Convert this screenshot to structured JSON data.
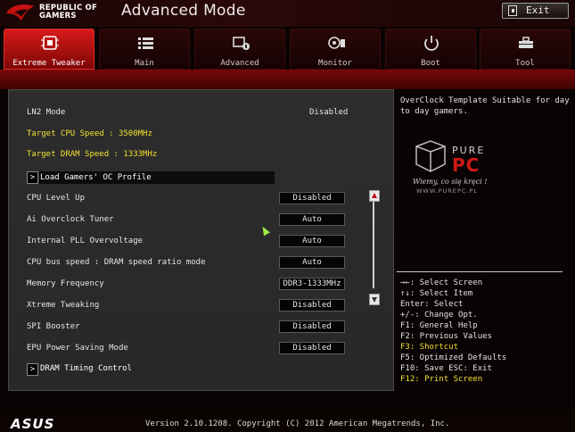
{
  "header": {
    "brand_line1": "REPUBLIC OF",
    "brand_line2": "GAMERS",
    "title": "Advanced Mode",
    "exit_label": "Exit"
  },
  "tabs": [
    {
      "label": "Extreme Tweaker",
      "icon": "cpu-chip-icon",
      "active": true
    },
    {
      "label": "Main",
      "icon": "list-icon",
      "active": false
    },
    {
      "label": "Advanced",
      "icon": "settings-info-icon",
      "active": false
    },
    {
      "label": "Monitor",
      "icon": "fan-gauge-icon",
      "active": false
    },
    {
      "label": "Boot",
      "icon": "power-icon",
      "active": false
    },
    {
      "label": "Tool",
      "icon": "toolbox-icon",
      "active": false
    }
  ],
  "settings": {
    "ln2_mode": {
      "label": "LN2 Mode",
      "value": "Disabled"
    },
    "target_cpu": "Target CPU Speed : 3500MHz",
    "target_dram": "Target DRAM Speed : 1333MHz",
    "load_profile": "Load Gamers' OC Profile",
    "items": [
      {
        "label": "CPU Level Up",
        "value": "Disabled"
      },
      {
        "label": "Ai Overclock Tuner",
        "value": "Auto"
      },
      {
        "label": "Internal PLL Overvoltage",
        "value": "Auto"
      },
      {
        "label": "CPU bus speed : DRAM speed ratio mode",
        "value": "Auto"
      },
      {
        "label": "Memory Frequency",
        "value": "DDR3-1333MHz"
      },
      {
        "label": "Xtreme Tweaking",
        "value": "Disabled"
      },
      {
        "label": "SPI Booster",
        "value": "Disabled"
      },
      {
        "label": "EPU Power Saving Mode",
        "value": "Disabled"
      }
    ],
    "dram_timing": "DRAM Timing Control"
  },
  "help": {
    "text": "OverClock Template Suitable for day to day gamers.",
    "watermark_brand": "PURE PC",
    "watermark_tag": "Wiemy, co się kręci !",
    "watermark_url": "WWW.PUREPC.PL"
  },
  "keys": [
    {
      "text": "→←: Select Screen",
      "highlight": false
    },
    {
      "text": "↑↓: Select Item",
      "highlight": false
    },
    {
      "text": "Enter: Select",
      "highlight": false
    },
    {
      "text": "+/-: Change Opt.",
      "highlight": false
    },
    {
      "text": "F1: General Help",
      "highlight": false
    },
    {
      "text": "F2: Previous Values",
      "highlight": false
    },
    {
      "text": "F3: Shortcut",
      "highlight": true
    },
    {
      "text": "F5: Optimized Defaults",
      "highlight": false
    },
    {
      "text": "F10: Save  ESC: Exit",
      "highlight": false
    },
    {
      "text": "F12: Print Screen",
      "highlight": true
    }
  ],
  "footer": {
    "logo": "ASUS",
    "copyright": "Version 2.10.1208. Copyright (C) 2012 American Megatrends, Inc."
  },
  "colors": {
    "accent_red": "#d81a1a",
    "highlight_yellow": "#f0e030",
    "panel_gray": "#2d2d2d"
  }
}
